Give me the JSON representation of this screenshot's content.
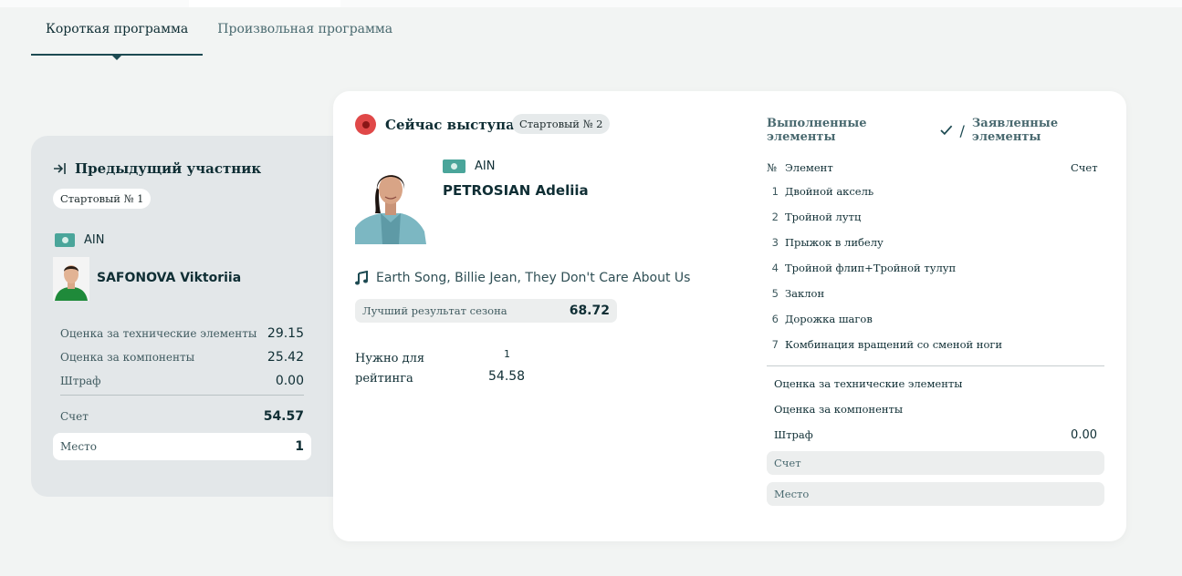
{
  "tabs": [
    {
      "label": "Короткая программа",
      "active": true
    },
    {
      "label": "Произвольная программа",
      "active": false
    }
  ],
  "previous": {
    "title": "Предыдущий участник",
    "start_badge": "Стартовый № 1",
    "nation": "AIN",
    "name": "SAFONOVA Viktoriia",
    "tes_label": "Оценка за технические элементы",
    "tes_value": "29.15",
    "pcs_label": "Оценка за компоненты",
    "pcs_value": "25.42",
    "penalty_label": "Штраф",
    "penalty_value": "0.00",
    "score_label": "Счет",
    "score_value": "54.57",
    "place_label": "Место",
    "place_value": "1"
  },
  "current": {
    "title": "Сейчас выступает",
    "start_badge": "Стартовый № 2",
    "nation": "AIN",
    "name": "PETROSIAN Adeliia",
    "music": "Earth Song, Billie Jean, They Don't Care About Us",
    "best_label": "Лучший результат сезона",
    "best_value": "68.72",
    "need_label": "Нужно для рейтинга",
    "need_rank": "1",
    "need_value": "54.58"
  },
  "elements": {
    "done_label": "Выполненные элементы",
    "declared_label": "Заявленные элементы",
    "col_no": "№",
    "col_element": "Элемент",
    "col_score": "Счет",
    "rows": [
      {
        "no": "1",
        "name": "Двойной аксель"
      },
      {
        "no": "2",
        "name": "Тройной лутц"
      },
      {
        "no": "3",
        "name": "Прыжок в либелу"
      },
      {
        "no": "4",
        "name": "Тройной флип+Тройной тулуп"
      },
      {
        "no": "5",
        "name": "Заклон"
      },
      {
        "no": "6",
        "name": "Дорожка шагов"
      },
      {
        "no": "7",
        "name": "Комбинация вращений со сменой ноги"
      }
    ],
    "tes_label": "Оценка за технические элементы",
    "pcs_label": "Оценка за компоненты",
    "penalty_label": "Штраф",
    "penalty_value": "0.00",
    "score_label": "Счет",
    "place_label": "Место"
  },
  "colors": {
    "accent": "#1d4a52",
    "live": "#e04848",
    "flag": "#4aa59a"
  }
}
